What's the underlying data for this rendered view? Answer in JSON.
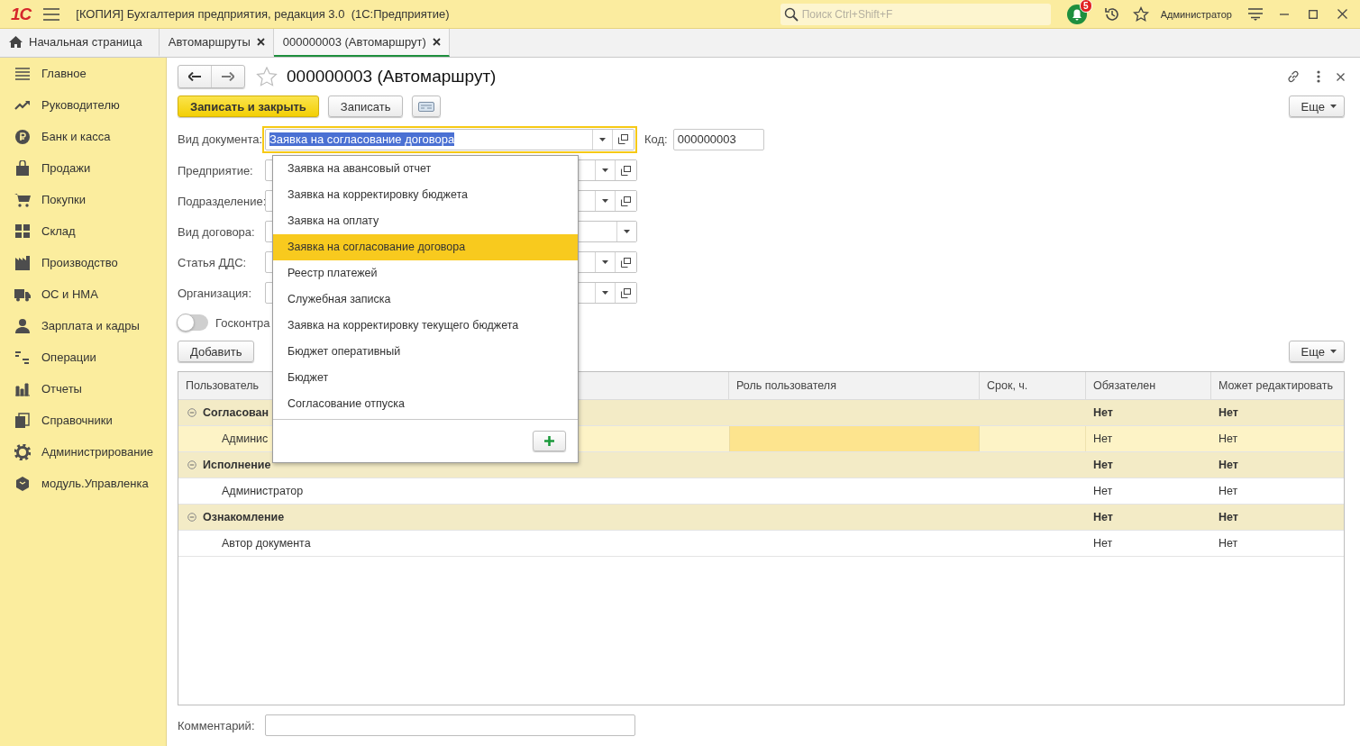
{
  "app": {
    "logo": "1С",
    "title": "[КОПИЯ] Бухгалтерия предприятия, редакция 3.0  (1С:Предприятие)",
    "search_placeholder": "Поиск Ctrl+Shift+F",
    "notifications": "5",
    "user": "Администратор"
  },
  "tabs": [
    {
      "kind": "home",
      "label": "Начальная страница",
      "selected": false
    },
    {
      "kind": "document",
      "label": "Автомаршруты",
      "selected": false
    },
    {
      "kind": "document",
      "label": "000000003 (Автомаршрут)",
      "selected": true
    }
  ],
  "sidebar": {
    "items": [
      {
        "label": "Главное"
      },
      {
        "label": "Руководителю"
      },
      {
        "label": "Банк и касса"
      },
      {
        "label": "Продажи"
      },
      {
        "label": "Покупки"
      },
      {
        "label": "Склад"
      },
      {
        "label": "Производство"
      },
      {
        "label": "ОС и НМА"
      },
      {
        "label": "Зарплата и кадры"
      },
      {
        "label": "Операции"
      },
      {
        "label": "Отчеты"
      },
      {
        "label": "Справочники"
      },
      {
        "label": "Администрирование"
      },
      {
        "label": "модуль.Управленка"
      }
    ]
  },
  "form": {
    "title": "000000003 (Автомаршрут)",
    "favorite": false,
    "buttons": [
      {
        "kind": "primary",
        "label": "Записать и закрыть"
      },
      {
        "kind": "normal",
        "label": "Записать"
      }
    ],
    "more_label": "Еще",
    "fields": [
      {
        "label": "Вид документа:",
        "value": "Заявка на согласование договора",
        "value_selected": true,
        "focused": true,
        "open_button": true
      },
      {
        "label": "Предприятие:",
        "focused": false,
        "open_button": true
      },
      {
        "label": "Подразделение:",
        "focused": false,
        "open_button": true
      },
      {
        "label": "Вид договора:",
        "focused": false,
        "open_button": false
      },
      {
        "label": "Статья ДДС:",
        "focused": false,
        "open_button": true
      },
      {
        "label": "Организация:",
        "focused": false,
        "open_button": true
      }
    ],
    "code": {
      "label": "Код:",
      "value": "000000003"
    },
    "toggle": {
      "label": "Госконтра",
      "on": false
    },
    "comment": {
      "label": "Комментарий:"
    }
  },
  "dropdown": {
    "items": [
      {
        "label": "Заявка на авансовый отчет",
        "selected": false
      },
      {
        "label": "Заявка на корректировку бюджета",
        "selected": false
      },
      {
        "label": "Заявка на оплату",
        "selected": false
      },
      {
        "label": "Заявка на согласование договора",
        "selected": true
      },
      {
        "label": "Реестр платежей",
        "selected": false
      },
      {
        "label": "Служебная записка",
        "selected": false
      },
      {
        "label": "Заявка на корректировку текущего бюджета",
        "selected": false
      },
      {
        "label": "Бюджет оперативный",
        "selected": false
      },
      {
        "label": "Бюджет",
        "selected": false
      },
      {
        "label": "Согласование отпуска",
        "selected": false
      }
    ]
  },
  "table": {
    "add_label": "Добавить",
    "more_label": "Еще",
    "columns": [
      "Пользователь",
      "Роль пользователя",
      "Срок, ч.",
      "Обязателен",
      "Может редактировать"
    ],
    "rows": [
      {
        "kind": "group",
        "expanded": true,
        "selected": false,
        "user": "Согласован",
        "required": "Нет",
        "editable": "Нет"
      },
      {
        "kind": "item",
        "selected": true,
        "user": "Админис",
        "required": "Нет",
        "editable": "Нет"
      },
      {
        "kind": "group",
        "expanded": true,
        "selected": false,
        "user": "Исполнение",
        "required": "Нет",
        "editable": "Нет"
      },
      {
        "kind": "item",
        "selected": false,
        "user": "Администратор",
        "required": "Нет",
        "editable": "Нет"
      },
      {
        "kind": "group",
        "expanded": true,
        "selected": false,
        "user": "Ознакомление",
        "required": "Нет",
        "editable": "Нет"
      },
      {
        "kind": "item",
        "selected": false,
        "user": "Автор документа",
        "required": "Нет",
        "editable": "Нет"
      }
    ]
  }
}
